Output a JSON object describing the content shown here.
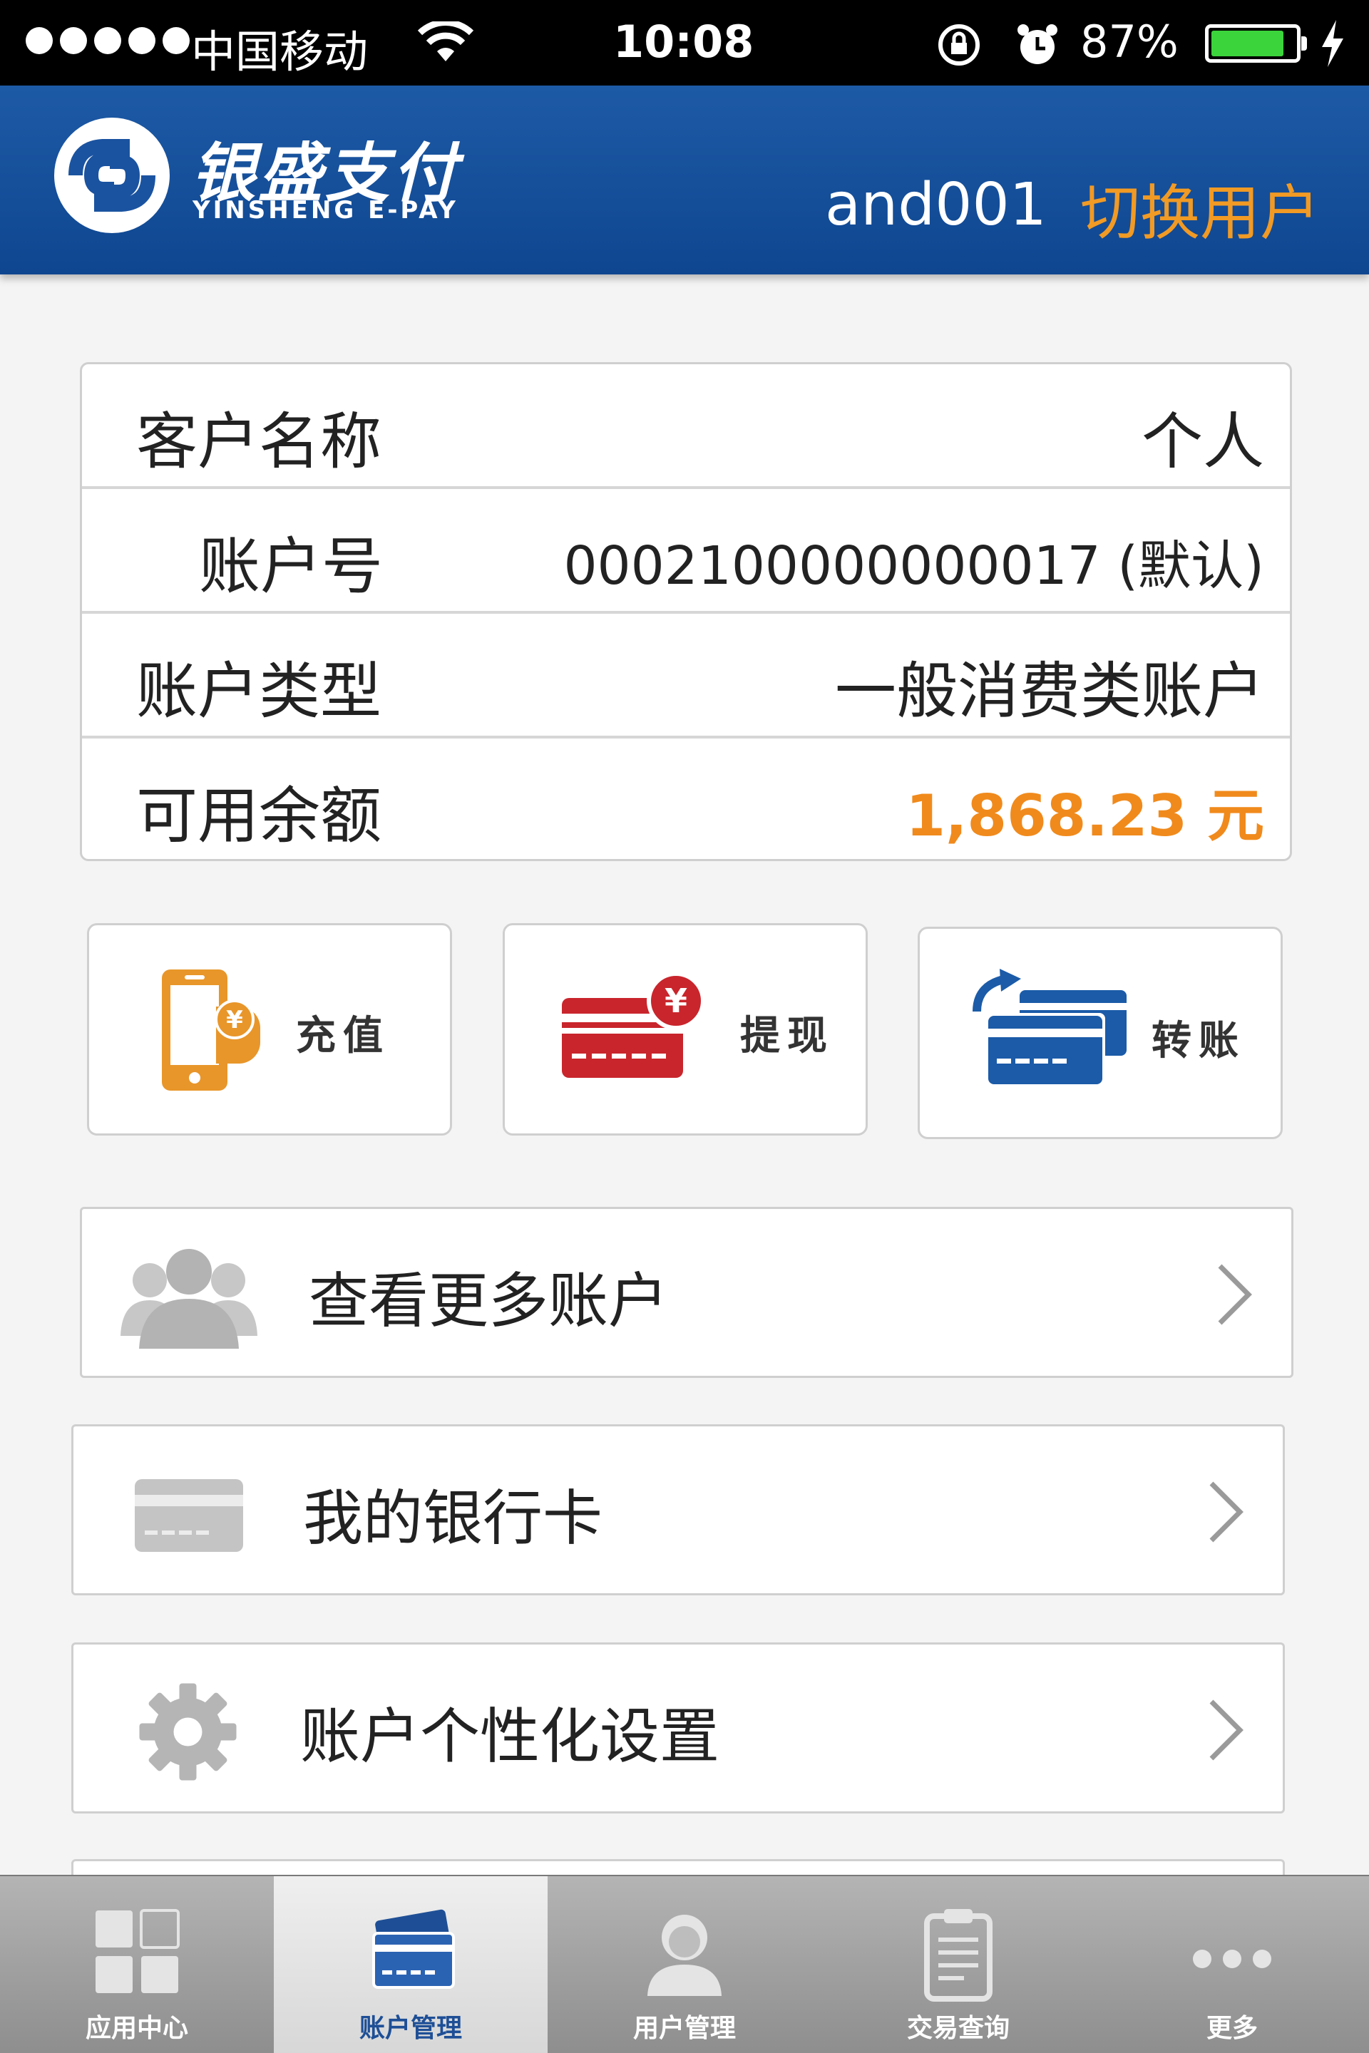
{
  "status_bar": {
    "carrier": "中国移动",
    "time": "10:08",
    "battery_percent": "87%",
    "battery_level": 0.87,
    "icons": [
      "signal-dots-icon",
      "wifi-icon",
      "rotation-lock-icon",
      "alarm-icon",
      "battery-icon",
      "charging-bolt-icon"
    ]
  },
  "header": {
    "brand_cn": "银盛支付",
    "brand_en": "YINSHENG E-PAY",
    "username": "and001",
    "switch_user": "切换用户",
    "colors": {
      "bar": "#1a53a0",
      "accent": "#f19a24"
    }
  },
  "account": {
    "rows": [
      {
        "label": "客户名称",
        "value": "个人"
      },
      {
        "label": "账户号",
        "value": "0002100000000017 (默认)"
      },
      {
        "label": "账户类型",
        "value": "一般消费类账户"
      },
      {
        "label": "可用余额",
        "value": "1,868.23 元"
      }
    ],
    "amount_color": "#f08a1c"
  },
  "actions": [
    {
      "label": "充值",
      "icon": "phone-recharge-icon"
    },
    {
      "label": "提现",
      "icon": "card-withdraw-icon"
    },
    {
      "label": "转账",
      "icon": "card-transfer-icon"
    }
  ],
  "menu": [
    {
      "label": "查看更多账户",
      "icon": "users-group-icon"
    },
    {
      "label": "我的银行卡",
      "icon": "bank-card-icon"
    },
    {
      "label": "账户个性化设置",
      "icon": "gear-icon"
    }
  ],
  "tabs": [
    {
      "label": "应用中心",
      "icon": "grid-icon",
      "active": false
    },
    {
      "label": "账户管理",
      "icon": "cards-icon",
      "active": true
    },
    {
      "label": "用户管理",
      "icon": "user-icon",
      "active": false
    },
    {
      "label": "交易查询",
      "icon": "clipboard-icon",
      "active": false
    },
    {
      "label": "更多",
      "icon": "more-dots-icon",
      "active": false
    }
  ]
}
